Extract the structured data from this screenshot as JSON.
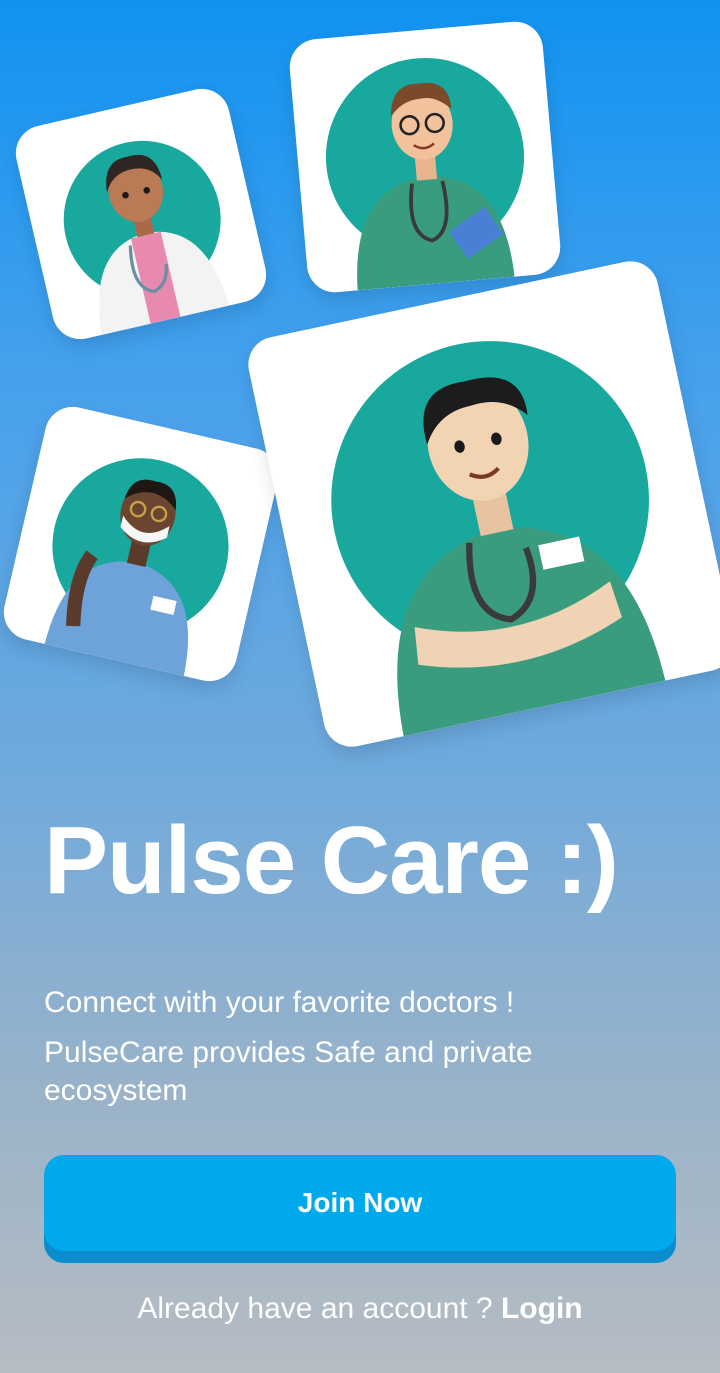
{
  "app": {
    "title": "Pulse Care :)",
    "subtitle": "Connect with your favorite doctors !",
    "description": "PulseCare provides Safe and private ecosystem"
  },
  "actions": {
    "join_label": "Join Now",
    "login_prompt": "Already have an account ?",
    "login_label": "Login"
  },
  "illustrations": [
    {
      "name": "female-doctor-avatar",
      "outfit": "white coat"
    },
    {
      "name": "doctor-with-clipboard-avatar",
      "outfit": "green scrubs"
    },
    {
      "name": "masked-nurse-avatar",
      "outfit": "blue scrubs"
    },
    {
      "name": "doctor-arms-crossed-avatar",
      "outfit": "green scrubs"
    }
  ],
  "colors": {
    "gradient_top": "#1193f1",
    "gradient_bottom": "#b6bcc3",
    "button": "#00a8ec",
    "button_shadow": "#0b8ccc",
    "avatar_circle": "#19a89e"
  }
}
